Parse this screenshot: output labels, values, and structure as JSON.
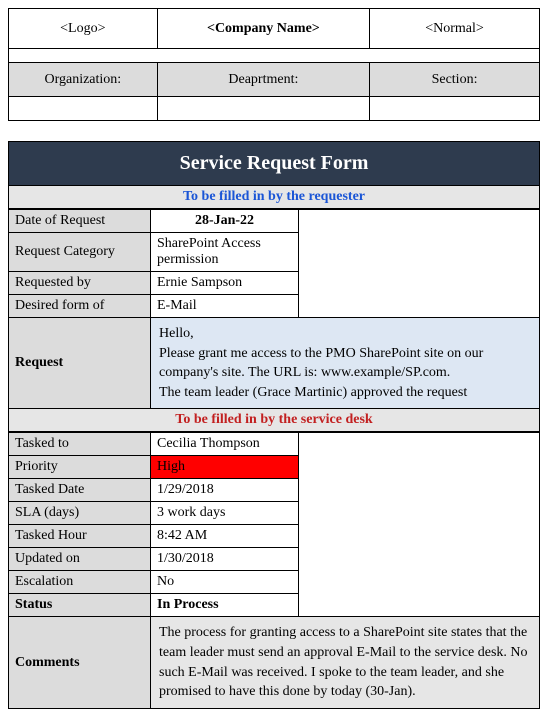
{
  "header": {
    "logo": "<Logo>",
    "company": "<Company Name>",
    "normal": "<Normal>"
  },
  "org": {
    "organization_label": "Organization:",
    "department_label": "Deaprtment:",
    "section_label": "Section:",
    "organization_value": "",
    "department_value": "",
    "section_value": ""
  },
  "form_title": "Service Request Form",
  "requester_section": "To be filled in by the requester",
  "service_section": "To be filled in by the service desk",
  "requester": {
    "date_label": "Date of Request",
    "date_value": "28-Jan-22",
    "category_label": "Request Category",
    "category_value": "SharePoint Access permission",
    "requested_by_label": "Requested by",
    "requested_by_value": "Ernie Sampson",
    "desired_form_label": "Desired form of",
    "desired_form_value": "E-Mail",
    "request_label": "Request",
    "request_value": "Hello,\nPlease grant me access to the PMO SharePoint site on our company's site. The URL is: www.example/SP.com.\nThe team leader (Grace Martinic) approved the request"
  },
  "service": {
    "tasked_to_label": "Tasked to",
    "tasked_to_value": "Cecilia Thompson",
    "priority_label": "Priority",
    "priority_value": "High",
    "tasked_date_label": "Tasked Date",
    "tasked_date_value": "1/29/2018",
    "sla_label": "SLA (days)",
    "sla_value": "3 work days",
    "tasked_hour_label": "Tasked Hour",
    "tasked_hour_value": "8:42 AM",
    "updated_label": "Updated on",
    "updated_value": "1/30/2018",
    "escalation_label": "Escalation",
    "escalation_value": "No",
    "status_label": "Status",
    "status_value": "In Process",
    "comments_label": "Comments",
    "comments_value": "The process for granting access to a SharePoint site states that the team leader must send an approval E-Mail to the service desk. No such E-Mail was received. I spoke to the team leader, and she promised to have this done by today (30-Jan)."
  }
}
